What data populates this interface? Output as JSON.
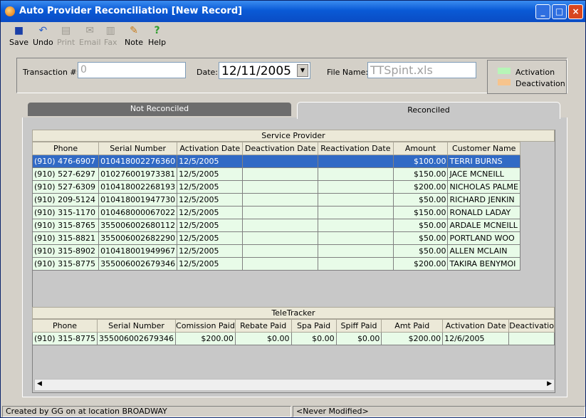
{
  "window": {
    "title": "Auto Provider Reconciliation [New Record]"
  },
  "toolbar": {
    "save": "Save",
    "undo": "Undo",
    "print": "Print",
    "email": "Email",
    "fax": "Fax",
    "note": "Note",
    "help": "Help"
  },
  "form": {
    "transaction_label": "Transaction #:",
    "transaction_value": "0",
    "date_label": "Date:",
    "date_value": "12/11/2005",
    "filename_label": "File Name:",
    "filename_value": "TTSpint.xls"
  },
  "legend": {
    "activation": "Activation",
    "deactivation": "Deactivation",
    "activation_color": "#b7f5b7",
    "deactivation_color": "#f7c48c"
  },
  "tabs": {
    "not_reconciled": "Not Reconciled",
    "reconciled": "Reconciled"
  },
  "service_provider": {
    "title": "Service Provider",
    "columns": [
      "Phone",
      "Serial Number",
      "Activation Date",
      "Deactivation Date",
      "Reactivation Date",
      "Amount",
      "Customer Name"
    ],
    "rows": [
      [
        "(910) 476-6907",
        "010418002276360",
        "12/5/2005",
        "",
        "",
        "$100.00",
        "TERRI BURNS"
      ],
      [
        "(910) 527-6297",
        "010276001973381",
        "12/5/2005",
        "",
        "",
        "$150.00",
        "JACE MCNEILL"
      ],
      [
        "(910) 527-6309",
        "010418002268193",
        "12/5/2005",
        "",
        "",
        "$200.00",
        "NICHOLAS PALME"
      ],
      [
        "(910) 209-5124",
        "010418001947730",
        "12/5/2005",
        "",
        "",
        "$50.00",
        "RICHARD JENKIN"
      ],
      [
        "(910) 315-1170",
        "010468000067022",
        "12/5/2005",
        "",
        "",
        "$150.00",
        "RONALD LADAY"
      ],
      [
        "(910) 315-8765",
        "355006002680112",
        "12/5/2005",
        "",
        "",
        "$50.00",
        "ARDALE MCNEILL"
      ],
      [
        "(910) 315-8821",
        "355006002682290",
        "12/5/2005",
        "",
        "",
        "$50.00",
        "PORTLAND WOO"
      ],
      [
        "(910) 315-8902",
        "010418001949967",
        "12/5/2005",
        "",
        "",
        "$50.00",
        "ALLEN MCLAIN"
      ],
      [
        "(910) 315-8775",
        "355006002679346",
        "12/5/2005",
        "",
        "",
        "$200.00",
        "TAKIRA BENYMOI"
      ]
    ]
  },
  "teletracker": {
    "title": "TeleTracker",
    "columns": [
      "Phone",
      "Serial Number",
      "Comission Paid",
      "Rebate Paid",
      "Spa Paid",
      "Spiff Paid",
      "Amt Paid",
      "Activation Date",
      "Deactivatio"
    ],
    "rows": [
      [
        "(910) 315-8775",
        "355006002679346",
        "$200.00",
        "$0.00",
        "$0.00",
        "$0.00",
        "$200.00",
        "12/6/2005",
        ""
      ]
    ]
  },
  "status": {
    "created": "Created by GG on  at location BROADWAY",
    "modified": "<Never Modified>"
  }
}
